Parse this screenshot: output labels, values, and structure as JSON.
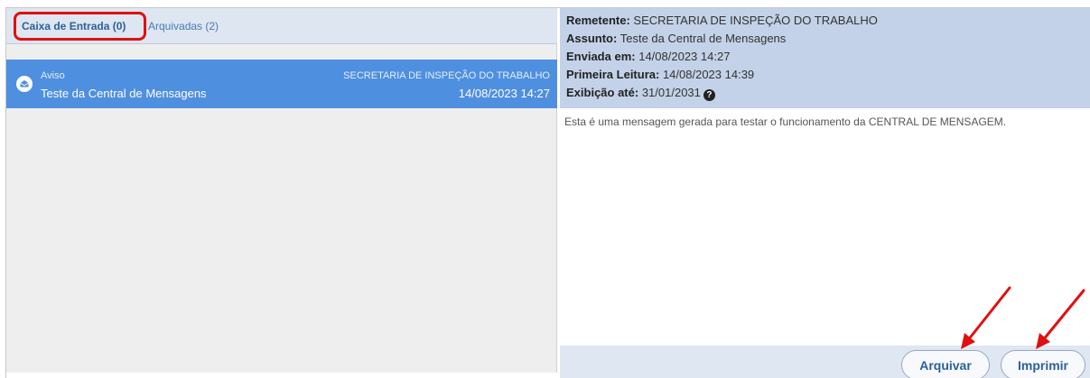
{
  "tabs": {
    "inbox": "Caixa de Entrada (0)",
    "archived": "Arquivadas (2)"
  },
  "messages": [
    {
      "type": "Aviso",
      "subject": "Teste da Central de Mensagens",
      "sender": "SECRETARIA DE INSPEÇÃO DO TRABALHO",
      "date": "14/08/2023 14:27",
      "icon": "envelope-open-icon"
    }
  ],
  "detail": {
    "sender_label": "Remetente:",
    "sender_value": "SECRETARIA DE INSPEÇÃO DO TRABALHO",
    "subject_label": "Assunto:",
    "subject_value": "Teste da Central de Mensagens",
    "sent_label": "Enviada em:",
    "sent_value": "14/08/2023 14:27",
    "first_read_label": "Primeira Leitura:",
    "first_read_value": "14/08/2023 14:39",
    "display_until_label": "Exibição até:",
    "display_until_value": "31/01/2031",
    "body": "Esta é uma mensagem gerada para testar o funcionamento da CENTRAL DE MENSAGEM."
  },
  "actions": {
    "archive": "Arquivar",
    "print": "Imprimir"
  },
  "colors": {
    "selected_row": "#4f8fe0",
    "header_bg": "#c3d2e8",
    "annotation": "#e01010"
  }
}
